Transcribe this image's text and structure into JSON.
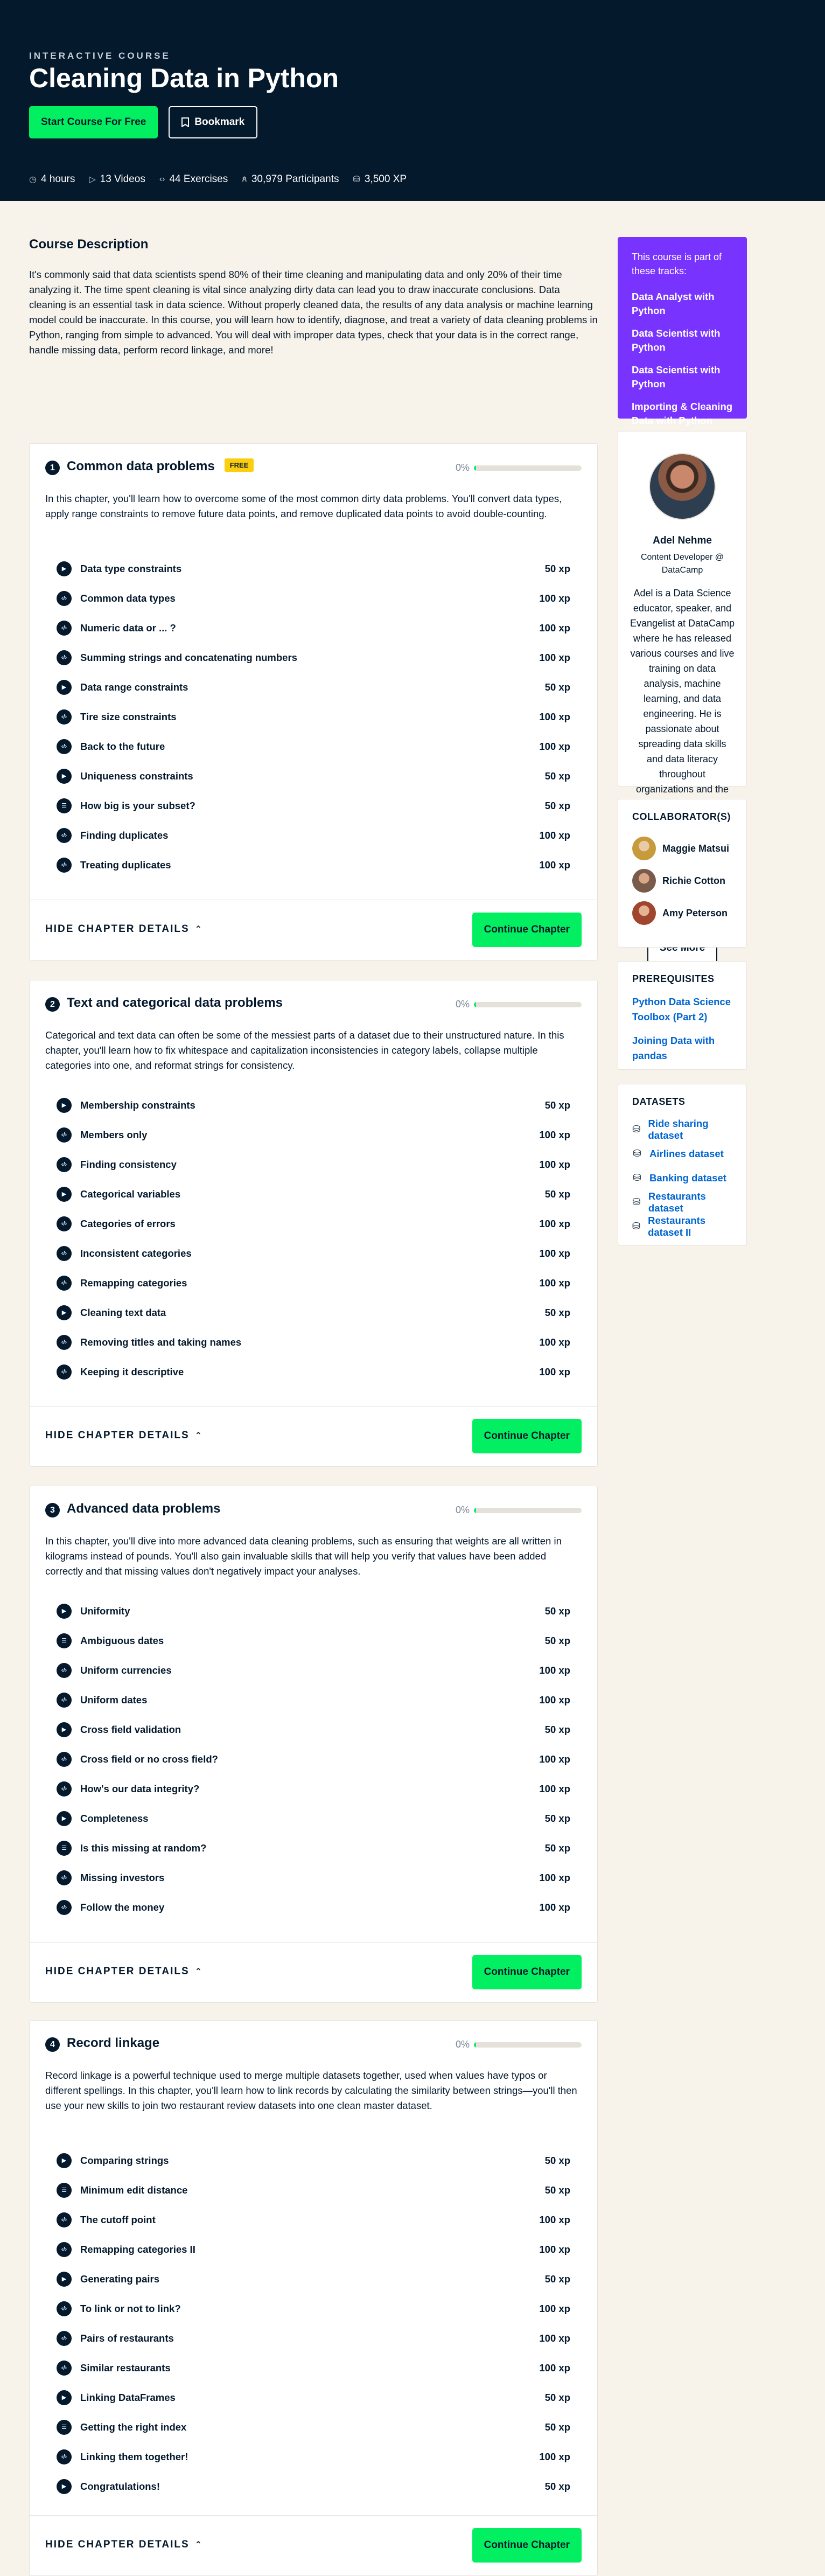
{
  "hero": {
    "kicker": "INTERACTIVE COURSE",
    "title": "Cleaning Data in Python",
    "start_label": "Start Course For Free",
    "bookmark_label": "Bookmark",
    "stats": {
      "hours": "4 hours",
      "videos": "13 Videos",
      "exercises": "44 Exercises",
      "participants": "30,979 Participants",
      "xp": "3,500 XP"
    }
  },
  "description": {
    "title": "Course Description",
    "text": "It's commonly said that data scientists spend 80% of their time cleaning and manipulating data and only 20% of their time analyzing it. The time spent cleaning is vital since analyzing dirty data can lead you to draw inaccurate conclusions. Data cleaning is an essential task in data science. Without properly cleaned data, the results of any data analysis or machine learning model could be inaccurate. In this course, you will learn how to identify, diagnose, and treat a variety of data cleaning problems in Python, ranging from simple to advanced. You will deal with improper data types, check that your data is in the correct range, handle missing data, perform record linkage, and more!"
  },
  "chapter_ui": {
    "hide_label": "HIDE CHAPTER DETAILS",
    "continue_label": "Continue Chapter",
    "free_badge": "FREE",
    "progress_label": "0%"
  },
  "chapters": [
    {
      "num": "1",
      "title": "Common data problems",
      "desc": "In this chapter, you'll learn how to overcome some of the most common dirty data problems. You'll convert data types, apply range constraints to remove future data points, and remove duplicated data points to avoid double-counting.",
      "exercises": [
        {
          "type": "video",
          "name": "Data type constraints",
          "xp": "50 xp"
        },
        {
          "type": "code",
          "name": "Common data types",
          "xp": "100 xp"
        },
        {
          "type": "code",
          "name": "Numeric data or ... ?",
          "xp": "100 xp"
        },
        {
          "type": "code",
          "name": "Summing strings and concatenating numbers",
          "xp": "100 xp"
        },
        {
          "type": "video",
          "name": "Data range constraints",
          "xp": "50 xp"
        },
        {
          "type": "code",
          "name": "Tire size constraints",
          "xp": "100 xp"
        },
        {
          "type": "code",
          "name": "Back to the future",
          "xp": "100 xp"
        },
        {
          "type": "video",
          "name": "Uniqueness constraints",
          "xp": "50 xp"
        },
        {
          "type": "mc",
          "name": "How big is your subset?",
          "xp": "50 xp"
        },
        {
          "type": "code",
          "name": "Finding duplicates",
          "xp": "100 xp"
        },
        {
          "type": "code",
          "name": "Treating duplicates",
          "xp": "100 xp"
        }
      ]
    },
    {
      "num": "2",
      "title": "Text and categorical data problems",
      "desc": "Categorical and text data can often be some of the messiest parts of a dataset due to their unstructured nature. In this chapter, you'll learn how to fix whitespace and capitalization inconsistencies in category labels, collapse multiple categories into one, and reformat strings for consistency.",
      "exercises": [
        {
          "type": "video",
          "name": "Membership constraints",
          "xp": "50 xp"
        },
        {
          "type": "code",
          "name": "Members only",
          "xp": "100 xp"
        },
        {
          "type": "code",
          "name": "Finding consistency",
          "xp": "100 xp"
        },
        {
          "type": "video",
          "name": "Categorical variables",
          "xp": "50 xp"
        },
        {
          "type": "code",
          "name": "Categories of errors",
          "xp": "100 xp"
        },
        {
          "type": "code",
          "name": "Inconsistent categories",
          "xp": "100 xp"
        },
        {
          "type": "code",
          "name": "Remapping categories",
          "xp": "100 xp"
        },
        {
          "type": "video",
          "name": "Cleaning text data",
          "xp": "50 xp"
        },
        {
          "type": "code",
          "name": "Removing titles and taking names",
          "xp": "100 xp"
        },
        {
          "type": "code",
          "name": "Keeping it descriptive",
          "xp": "100 xp"
        }
      ]
    },
    {
      "num": "3",
      "title": "Advanced data problems",
      "desc": "In this chapter, you'll dive into more advanced data cleaning problems, such as ensuring that weights are all written in kilograms instead of pounds. You'll also gain invaluable skills that will help you verify that values have been added correctly and that missing values don't negatively impact your analyses.",
      "exercises": [
        {
          "type": "video",
          "name": "Uniformity",
          "xp": "50 xp"
        },
        {
          "type": "mc",
          "name": "Ambiguous dates",
          "xp": "50 xp"
        },
        {
          "type": "code",
          "name": "Uniform currencies",
          "xp": "100 xp"
        },
        {
          "type": "code",
          "name": "Uniform dates",
          "xp": "100 xp"
        },
        {
          "type": "video",
          "name": "Cross field validation",
          "xp": "50 xp"
        },
        {
          "type": "code",
          "name": "Cross field or no cross field?",
          "xp": "100 xp"
        },
        {
          "type": "code",
          "name": "How's our data integrity?",
          "xp": "100 xp"
        },
        {
          "type": "video",
          "name": "Completeness",
          "xp": "50 xp"
        },
        {
          "type": "mc",
          "name": "Is this missing at random?",
          "xp": "50 xp"
        },
        {
          "type": "code",
          "name": "Missing investors",
          "xp": "100 xp"
        },
        {
          "type": "code",
          "name": "Follow the money",
          "xp": "100 xp"
        }
      ]
    },
    {
      "num": "4",
      "title": "Record linkage",
      "desc": "Record linkage is a powerful technique used to merge multiple datasets together, used when values have typos or different spellings. In this chapter, you'll learn how to link records by calculating the similarity between strings—you'll then use your new skills to join two restaurant review datasets into one clean master dataset.",
      "exercises": [
        {
          "type": "video",
          "name": "Comparing strings",
          "xp": "50 xp"
        },
        {
          "type": "mc",
          "name": "Minimum edit distance",
          "xp": "50 xp"
        },
        {
          "type": "code",
          "name": "The cutoff point",
          "xp": "100 xp"
        },
        {
          "type": "code",
          "name": "Remapping categories II",
          "xp": "100 xp"
        },
        {
          "type": "video",
          "name": "Generating pairs",
          "xp": "50 xp"
        },
        {
          "type": "code",
          "name": "To link or not to link?",
          "xp": "100 xp"
        },
        {
          "type": "code",
          "name": "Pairs of restaurants",
          "xp": "100 xp"
        },
        {
          "type": "code",
          "name": "Similar restaurants",
          "xp": "100 xp"
        },
        {
          "type": "video",
          "name": "Linking DataFrames",
          "xp": "50 xp"
        },
        {
          "type": "mc",
          "name": "Getting the right index",
          "xp": "50 xp"
        },
        {
          "type": "code",
          "name": "Linking them together!",
          "xp": "100 xp"
        },
        {
          "type": "video",
          "name": "Congratulations!",
          "xp": "50 xp"
        }
      ]
    }
  ],
  "tracks": {
    "intro": "This course is part of these tracks:",
    "items": [
      "Data Analyst with Python",
      "Data Scientist with Python",
      "Data Scientist with Python",
      "Importing & Cleaning Data with Python"
    ]
  },
  "author": {
    "name": "Adel Nehme",
    "role": "Content Developer @ DataCamp",
    "bio": "Adel is a Data Science educator, speaker, and Evangelist at DataCamp where he has released various courses and live training on data analysis, machine learning, and data engineering. He is passionate about spreading data skills and data literacy throughout organizations and the intersection of technology and society. He has an MSc in Data Science and Business Analytics. In his free time, you can find him hanging out with his cat Louis.",
    "see_more": "See More"
  },
  "collaborators": {
    "title": "COLLABORATOR(S)",
    "items": [
      "Maggie Matsui",
      "Richie Cotton",
      "Amy Peterson"
    ]
  },
  "prerequisites": {
    "title": "PREREQUISITES",
    "items": [
      "Python Data Science Toolbox (Part 2)",
      "Joining Data with pandas"
    ]
  },
  "datasets": {
    "title": "DATASETS",
    "items": [
      "Ride sharing dataset",
      "Airlines dataset",
      "Banking dataset",
      "Restaurants dataset",
      "Restaurants dataset II"
    ]
  },
  "colors": {
    "navy": "#05192d",
    "green": "#03ef62",
    "purple": "#7933ff",
    "link": "#0065d1",
    "free_badge": "#fcce0d"
  }
}
